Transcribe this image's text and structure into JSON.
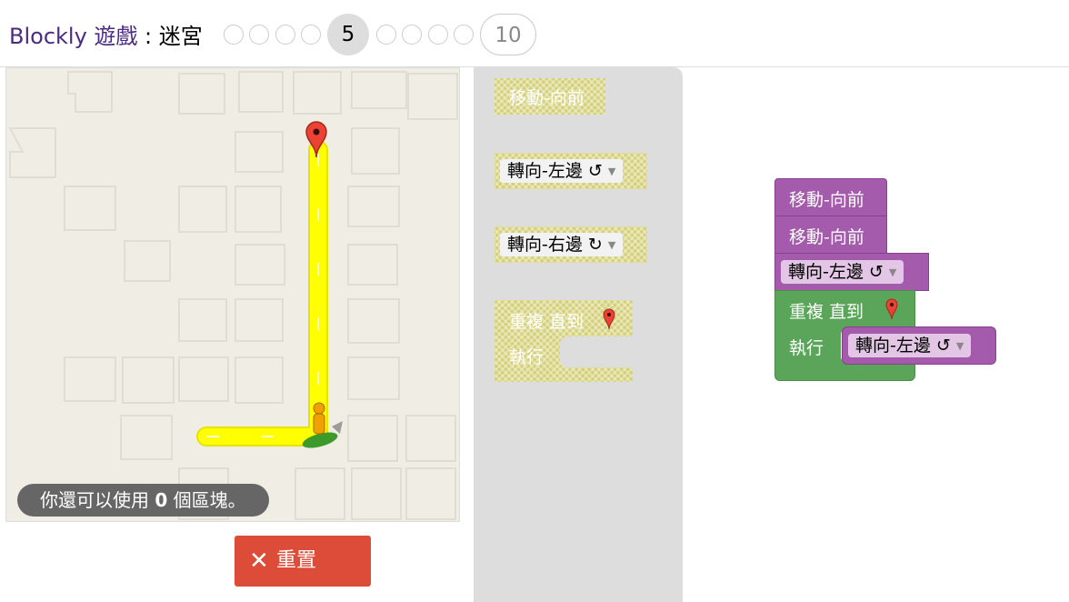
{
  "header": {
    "app_name": "Blockly",
    "games_label": "遊戲",
    "separator": " : ",
    "game_title": "迷宮",
    "levels": [
      "1",
      "2",
      "3",
      "4",
      "5",
      "6",
      "7",
      "8",
      "9",
      "10"
    ],
    "current_level": "5",
    "last_level": "10"
  },
  "maze": {
    "capacity_prefix": "你還可以使用 ",
    "capacity_count": "0",
    "capacity_suffix": " 個區塊。"
  },
  "reset_button": {
    "icon": "close-icon",
    "label": "重置"
  },
  "toolbox": {
    "move_forward": "移動-向前",
    "turn_left_label": "轉向-左邊 ↺",
    "turn_right_label": "轉向-右邊 ↻",
    "repeat_until": "重複 直到",
    "do_label": "執行"
  },
  "workspace": {
    "move1": "移動-向前",
    "move2": "移動-向前",
    "turn_left": "轉向-左邊 ↺",
    "repeat_until": "重複 直到",
    "do_label": "執行",
    "inner_turn_left": "轉向-左邊 ↺"
  },
  "colors": {
    "title_link": "#4b2b82",
    "reset_bg": "#dd4b39",
    "path": "#ffff00",
    "block_purple": "#a55bac",
    "block_green": "#5ba55b",
    "marker": "#ea4335"
  }
}
